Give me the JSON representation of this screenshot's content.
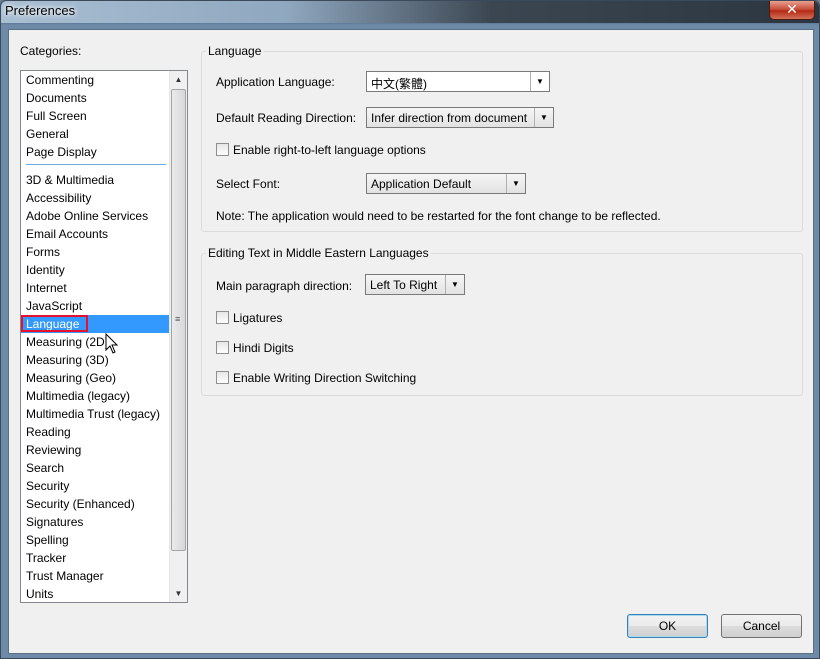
{
  "window": {
    "title": "Preferences",
    "close_symbol": "✕"
  },
  "categories": {
    "label": "Categories:",
    "group1": [
      "Commenting",
      "Documents",
      "Full Screen",
      "General",
      "Page Display"
    ],
    "group2": [
      "3D & Multimedia",
      "Accessibility",
      "Adobe Online Services",
      "Email Accounts",
      "Forms",
      "Identity",
      "Internet",
      "JavaScript",
      "Language",
      "Measuring (2D)",
      "Measuring (3D)",
      "Measuring (Geo)",
      "Multimedia (legacy)",
      "Multimedia Trust (legacy)",
      "Reading",
      "Reviewing",
      "Search",
      "Security",
      "Security (Enhanced)",
      "Signatures",
      "Spelling",
      "Tracker",
      "Trust Manager",
      "Units"
    ],
    "selected": "Language"
  },
  "language_group": {
    "title": "Language",
    "app_language_label": "Application Language:",
    "app_language_value": "中文(繁體)",
    "reading_direction_label": "Default Reading Direction:",
    "reading_direction_value": "Infer direction from document",
    "rtl_options_label": "Enable right-to-left language options",
    "rtl_options_checked": false,
    "select_font_label": "Select Font:",
    "select_font_value": "Application Default",
    "note": "Note: The application would need to be restarted for the font change to be reflected."
  },
  "middle_east_group": {
    "title": "Editing Text in Middle Eastern Languages",
    "paragraph_direction_label": "Main paragraph direction:",
    "paragraph_direction_value": "Left To Right",
    "ligatures_label": "Ligatures",
    "ligatures_checked": false,
    "hindi_digits_label": "Hindi Digits",
    "hindi_digits_checked": false,
    "writing_direction_label": "Enable Writing Direction Switching",
    "writing_direction_checked": false
  },
  "buttons": {
    "ok": "OK",
    "cancel": "Cancel"
  },
  "icons": {
    "scroll_up": "▲",
    "scroll_down": "▼",
    "dropdown": "▼",
    "grip": "≡"
  }
}
